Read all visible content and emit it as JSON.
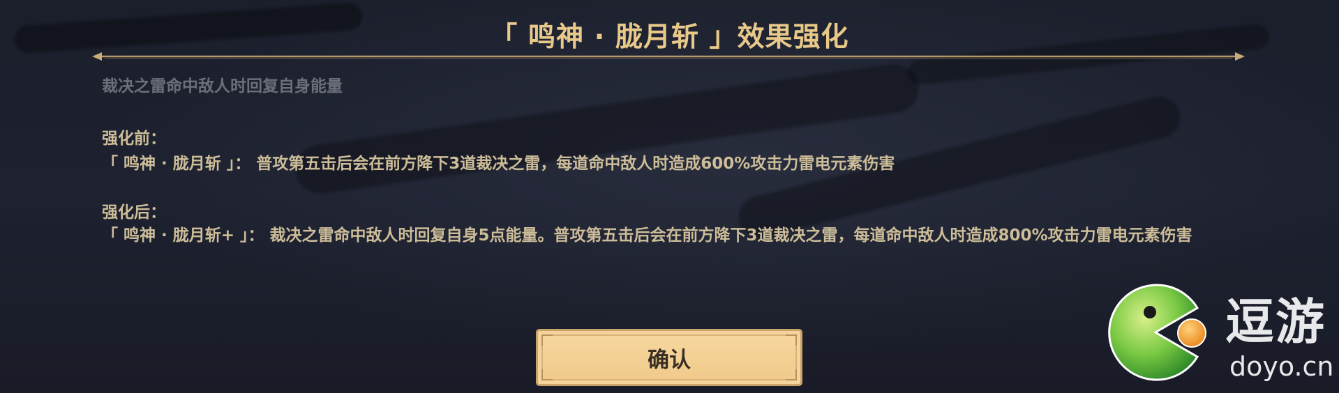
{
  "dialog": {
    "title": "「 鸣神 · 胧月斩 」效果强化",
    "subtitle": "裁决之雷命中敌人时回复自身能量",
    "before_label": "强化前：",
    "before_text": "「 鸣神 · 胧月斩 」： 普攻第五击后会在前方降下3道裁决之雷，每道命中敌人时造成600%攻击力雷电元素伤害",
    "after_label": "强化后：",
    "after_text": "「 鸣神 · 胧月斩+ 」： 裁决之雷命中敌人时回复自身5点能量。普攻第五击后会在前方降下3道裁决之雷，每道命中敌人时造成800%攻击力雷电元素伤害",
    "confirm_label": "确认"
  },
  "watermark": {
    "name_cn": "逗游",
    "domain": "doyo.cn",
    "icon": "pacman-logo-icon"
  },
  "colors": {
    "background": "#1b1f2c",
    "title": "#e9c98a",
    "body_text": "#cdbd99",
    "muted_text": "#6b6f79",
    "button_fill": "#f3cf93",
    "button_text": "#3a2f24",
    "logo_green": "#7ac943",
    "logo_orange": "#f39a1e"
  }
}
